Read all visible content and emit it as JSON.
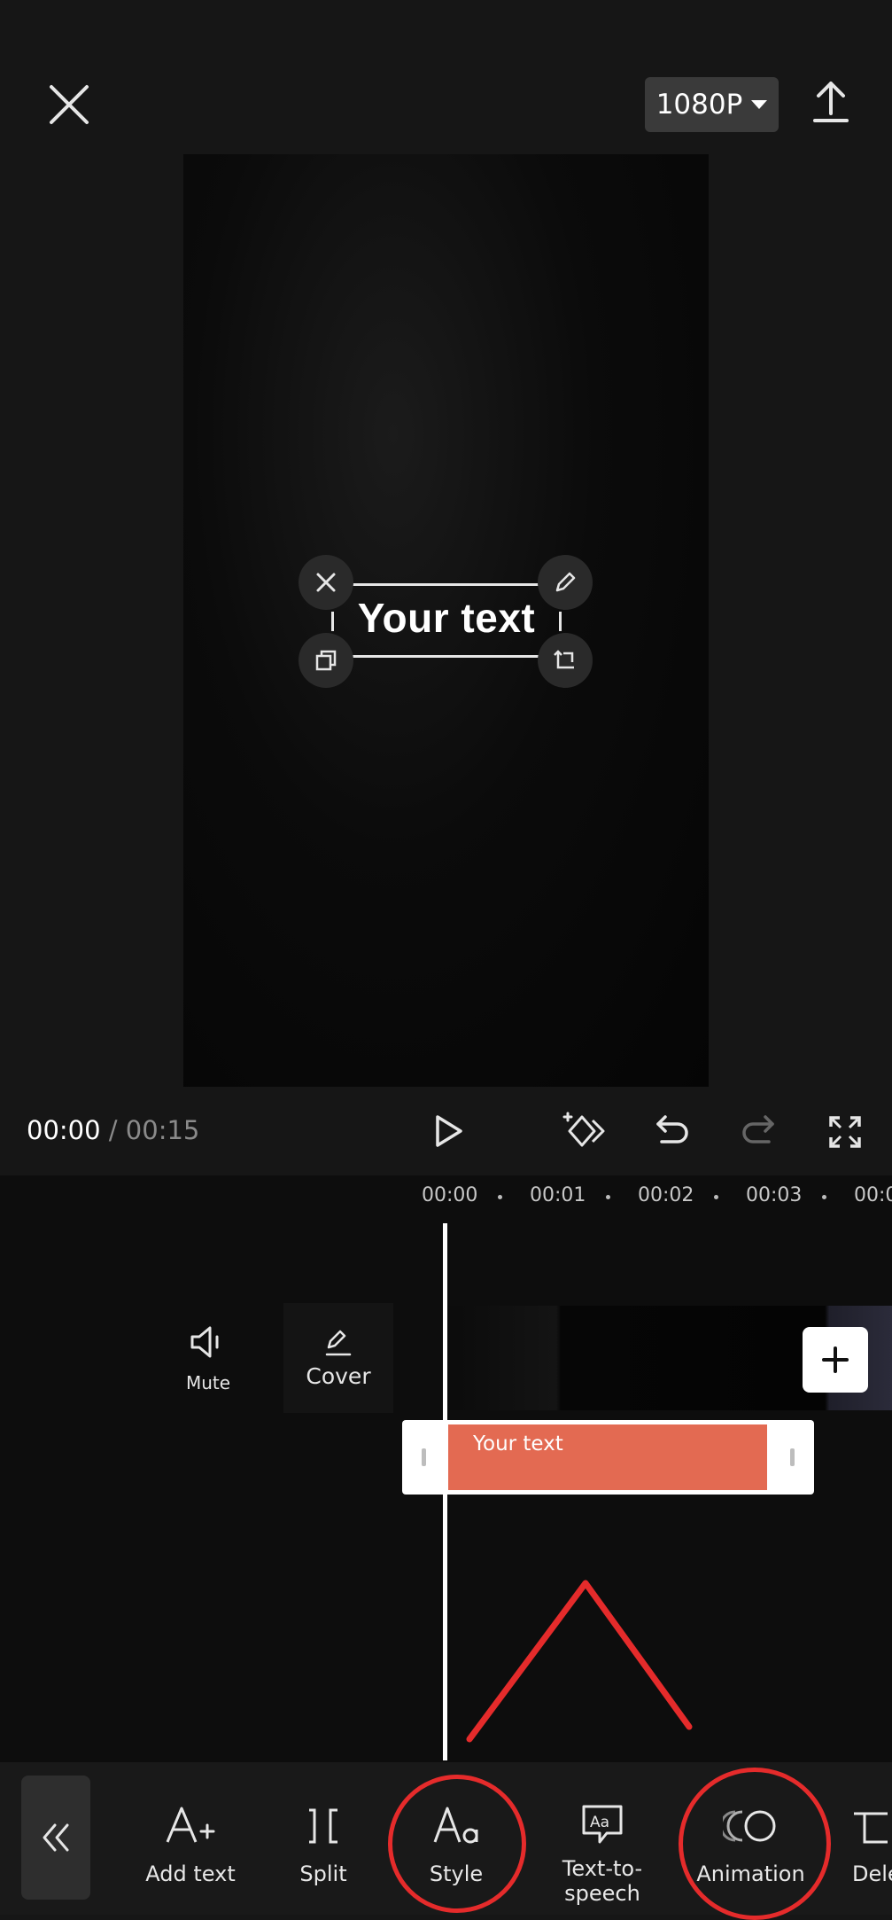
{
  "top_bar": {
    "resolution": "1080P"
  },
  "preview": {
    "overlay_text": "Your text"
  },
  "playback": {
    "current_time": "00:00",
    "separator": " / ",
    "total_time": "00:15"
  },
  "timeline": {
    "timestamps": [
      "00:00",
      "00:01",
      "00:02",
      "00:03",
      "00:0"
    ],
    "mute_label": "Mute",
    "cover_label": "Cover",
    "text_clip_label": "Your text"
  },
  "toolbar": {
    "items": [
      {
        "label": "Add text",
        "icon": "add-text-icon"
      },
      {
        "label": "Split",
        "icon": "split-icon"
      },
      {
        "label": "Style",
        "icon": "style-icon"
      },
      {
        "label": "Text-to-\nspeech",
        "icon": "text-to-speech-icon"
      },
      {
        "label": "Animation",
        "icon": "animation-icon"
      },
      {
        "label": "Dele",
        "icon": "delete-icon"
      }
    ]
  },
  "colors": {
    "background": "#161616",
    "text_clip": "#e36a52",
    "annotation_red": "#e52b2b"
  }
}
